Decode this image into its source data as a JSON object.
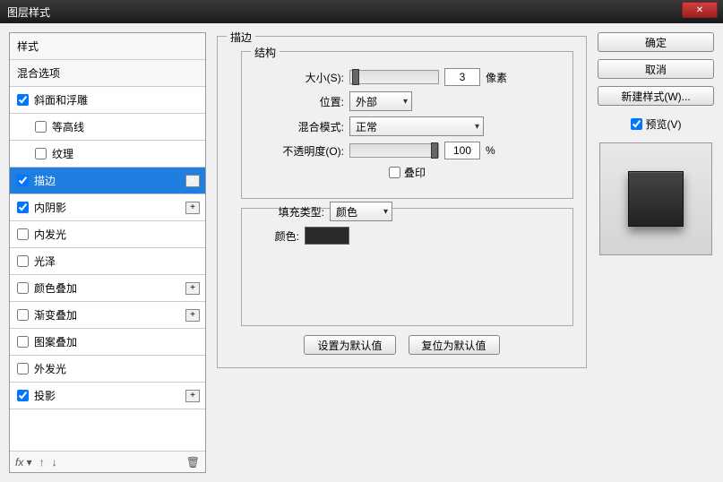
{
  "title": "图层样式",
  "sidebar": {
    "items": [
      {
        "label": "样式",
        "type": "header"
      },
      {
        "label": "混合选项",
        "type": "header"
      },
      {
        "label": "斜面和浮雕",
        "checked": true,
        "plus": false
      },
      {
        "label": "等高线",
        "checked": false,
        "indent": true
      },
      {
        "label": "纹理",
        "checked": false,
        "indent": true
      },
      {
        "label": "描边",
        "checked": true,
        "selected": true,
        "plus": true
      },
      {
        "label": "内阴影",
        "checked": true,
        "plus": true
      },
      {
        "label": "内发光",
        "checked": false
      },
      {
        "label": "光泽",
        "checked": false
      },
      {
        "label": "颜色叠加",
        "checked": false,
        "plus": true
      },
      {
        "label": "渐变叠加",
        "checked": false,
        "plus": true
      },
      {
        "label": "图案叠加",
        "checked": false
      },
      {
        "label": "外发光",
        "checked": false
      },
      {
        "label": "投影",
        "checked": true,
        "plus": true
      }
    ],
    "footer": {
      "fx": "fx",
      "trash": "🗑"
    }
  },
  "panel": {
    "title": "描边",
    "structure_title": "结构",
    "size_label": "大小(S):",
    "size_value": "3",
    "size_unit": "像素",
    "position_label": "位置:",
    "position_value": "外部",
    "blend_label": "混合模式:",
    "blend_value": "正常",
    "opacity_label": "不透明度(O):",
    "opacity_value": "100",
    "opacity_unit": "%",
    "overprint_label": "叠印",
    "filltype_label": "填充类型:",
    "filltype_value": "颜色",
    "color_label": "颜色:",
    "color_value": "#2a2a2a",
    "set_default": "设置为默认值",
    "reset_default": "复位为默认值"
  },
  "right": {
    "ok": "确定",
    "cancel": "取消",
    "new_style": "新建样式(W)...",
    "preview_label": "预览(V)",
    "preview_checked": true
  }
}
